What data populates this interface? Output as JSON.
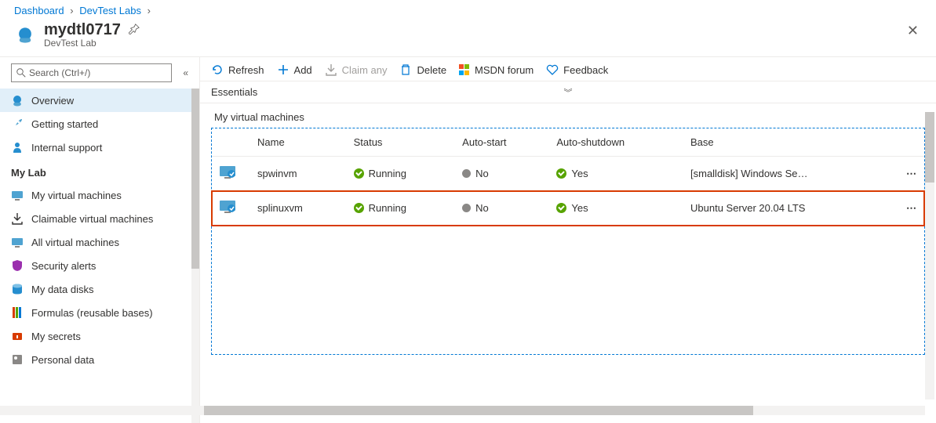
{
  "breadcrumb": {
    "items": [
      "Dashboard",
      "DevTest Labs"
    ]
  },
  "header": {
    "title": "mydtl0717",
    "subtitle": "DevTest Lab"
  },
  "search": {
    "placeholder": "Search (Ctrl+/)"
  },
  "sidebar": {
    "top": [
      {
        "label": "Overview",
        "icon": "overview"
      },
      {
        "label": "Getting started",
        "icon": "getting-started"
      },
      {
        "label": "Internal support",
        "icon": "support"
      }
    ],
    "section_label": "My Lab",
    "items": [
      {
        "label": "My virtual machines",
        "icon": "vm"
      },
      {
        "label": "Claimable virtual machines",
        "icon": "claim"
      },
      {
        "label": "All virtual machines",
        "icon": "vm"
      },
      {
        "label": "Security alerts",
        "icon": "security"
      },
      {
        "label": "My data disks",
        "icon": "disk"
      },
      {
        "label": "Formulas (reusable bases)",
        "icon": "formula"
      },
      {
        "label": "My secrets",
        "icon": "secret"
      },
      {
        "label": "Personal data",
        "icon": "personal"
      }
    ]
  },
  "toolbar": {
    "refresh": "Refresh",
    "add": "Add",
    "claim": "Claim any",
    "delete": "Delete",
    "msdn": "MSDN forum",
    "feedback": "Feedback"
  },
  "essentials": {
    "label": "Essentials"
  },
  "vm_section": {
    "title": "My virtual machines",
    "columns": [
      "Name",
      "Status",
      "Auto-start",
      "Auto-shutdown",
      "Base"
    ],
    "rows": [
      {
        "name": "spwinvm",
        "status": "Running",
        "autostart": "No",
        "autoshutdown": "Yes",
        "base": "[smalldisk] Windows Se…",
        "highlight": false
      },
      {
        "name": "splinuxvm",
        "status": "Running",
        "autostart": "No",
        "autoshutdown": "Yes",
        "base": "Ubuntu Server 20.04 LTS",
        "highlight": true
      }
    ]
  }
}
